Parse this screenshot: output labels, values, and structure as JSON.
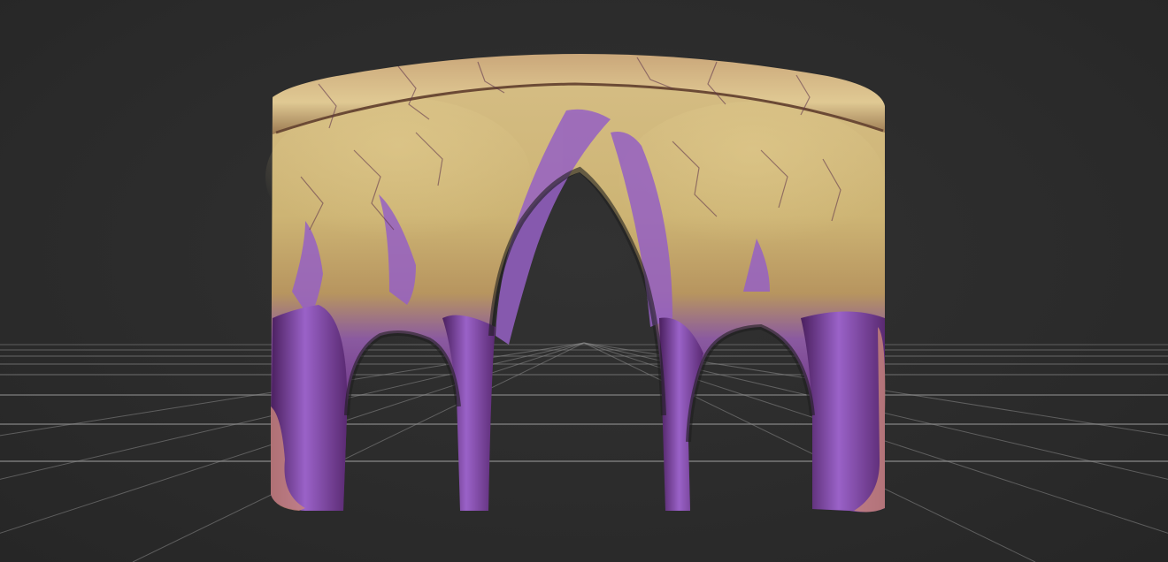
{
  "viewport": {
    "background_color": "#2b2b2b",
    "grid_color": "#8a8a8a"
  },
  "model": {
    "icon": "gothic-arch-mesh-icon",
    "colors": {
      "stone_light": "#d9c38a",
      "stone_mid": "#c4aa6a",
      "stone_dark": "#a58a55",
      "rim_pink": "#b98a78",
      "purple_light": "#b58ad8",
      "purple_mid": "#8a4db8",
      "purple_dark": "#4a1f5e",
      "foot_pink": "#c9867a",
      "crack": "#5a2f4a"
    }
  }
}
